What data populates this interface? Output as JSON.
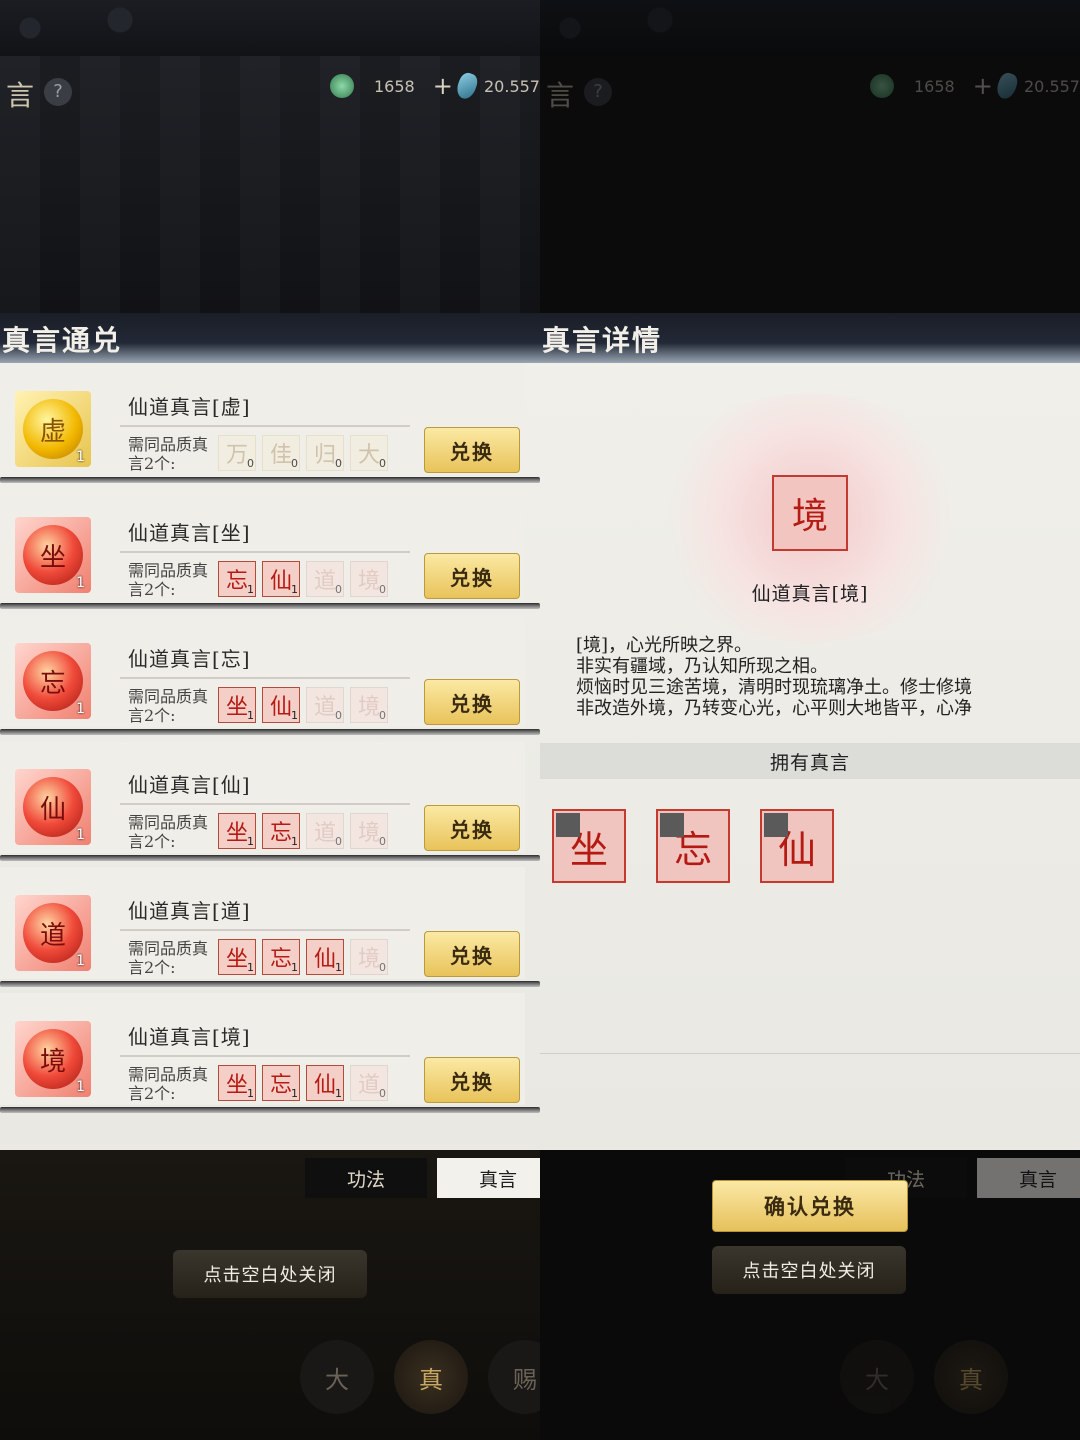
{
  "left": {
    "top_title": "言",
    "help_label": "?",
    "jade_value": "1658",
    "plus_label": "+",
    "gem_value": "20.557",
    "dialog_title": "真言通兑",
    "req_label": "需同品质真言2个:",
    "exchange_label": "兑换",
    "rows": [
      {
        "name": "仙道真言[虚]",
        "glyph": "虚",
        "count": "1",
        "frame": "gold",
        "slots": [
          {
            "g": "万",
            "c": "0",
            "s": "gold-empty"
          },
          {
            "g": "佳",
            "c": "0",
            "s": "gold-empty"
          },
          {
            "g": "归",
            "c": "0",
            "s": "gold-empty"
          },
          {
            "g": "大",
            "c": "0",
            "s": "gold-empty"
          }
        ]
      },
      {
        "name": "仙道真言[坐]",
        "glyph": "坐",
        "count": "1",
        "frame": "red",
        "slots": [
          {
            "g": "忘",
            "c": "1",
            "s": "owned"
          },
          {
            "g": "仙",
            "c": "1",
            "s": "owned"
          },
          {
            "g": "道",
            "c": "0",
            "s": "empty"
          },
          {
            "g": "境",
            "c": "0",
            "s": "empty"
          }
        ]
      },
      {
        "name": "仙道真言[忘]",
        "glyph": "忘",
        "count": "1",
        "frame": "red",
        "slots": [
          {
            "g": "坐",
            "c": "1",
            "s": "owned"
          },
          {
            "g": "仙",
            "c": "1",
            "s": "owned"
          },
          {
            "g": "道",
            "c": "0",
            "s": "empty"
          },
          {
            "g": "境",
            "c": "0",
            "s": "empty"
          }
        ]
      },
      {
        "name": "仙道真言[仙]",
        "glyph": "仙",
        "count": "1",
        "frame": "red",
        "slots": [
          {
            "g": "坐",
            "c": "1",
            "s": "owned"
          },
          {
            "g": "忘",
            "c": "1",
            "s": "owned"
          },
          {
            "g": "道",
            "c": "0",
            "s": "empty"
          },
          {
            "g": "境",
            "c": "0",
            "s": "empty"
          }
        ]
      },
      {
        "name": "仙道真言[道]",
        "glyph": "道",
        "count": "1",
        "frame": "red",
        "slots": [
          {
            "g": "坐",
            "c": "1",
            "s": "owned"
          },
          {
            "g": "忘",
            "c": "1",
            "s": "owned"
          },
          {
            "g": "仙",
            "c": "1",
            "s": "owned"
          },
          {
            "g": "境",
            "c": "0",
            "s": "empty"
          }
        ]
      },
      {
        "name": "仙道真言[境]",
        "glyph": "境",
        "count": "1",
        "frame": "red",
        "slots": [
          {
            "g": "坐",
            "c": "1",
            "s": "owned"
          },
          {
            "g": "忘",
            "c": "1",
            "s": "owned"
          },
          {
            "g": "仙",
            "c": "1",
            "s": "owned"
          },
          {
            "g": "道",
            "c": "0",
            "s": "empty"
          }
        ]
      }
    ],
    "tab_gongfa": "功法",
    "tab_zhenyan": "真言",
    "close_hint": "点击空白处关闭",
    "nav": [
      "大",
      "真",
      "赐"
    ]
  },
  "right": {
    "top_title": "言",
    "help_label": "?",
    "jade_value": "1658",
    "plus_label": "+",
    "gem_value": "20.557",
    "dialog_title": "真言详情",
    "emblem_glyph": "境",
    "detail_name": "仙道真言[境]",
    "desc_lines": [
      "[境]，心光所映之界。",
      "非实有疆域，乃认知所现之相。",
      "烦恼时见三途苦境，清明时现琉璃净土。修士修境",
      "非改造外境，乃转变心光，心平则大地皆平，心净"
    ],
    "own_header": "拥有真言",
    "owned": [
      "坐",
      "忘",
      "仙"
    ],
    "confirm_label": "确认兑换",
    "close_hint": "点击空白处关闭",
    "tab_gongfa": "功法",
    "tab_zhenyan": "真言",
    "nav": [
      "大",
      "真"
    ]
  }
}
